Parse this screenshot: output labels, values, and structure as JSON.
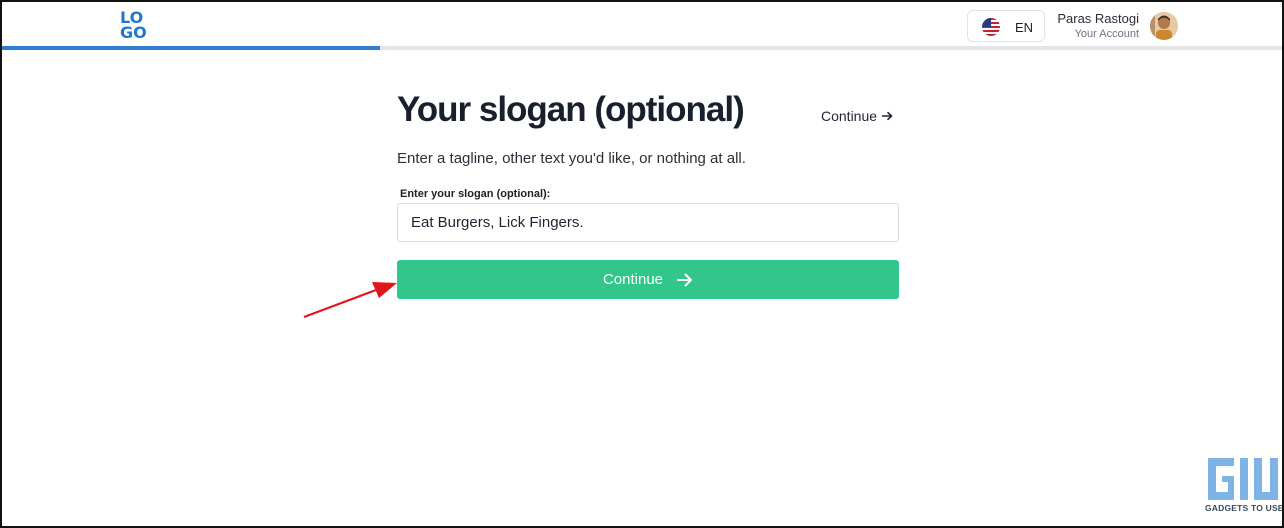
{
  "header": {
    "logo_lines": [
      "LO",
      "GO"
    ],
    "progress_fraction": 0.295,
    "language": {
      "code": "EN",
      "flag_icon": "us-flag-icon"
    },
    "user": {
      "name": "Paras Rastogi",
      "subtitle": "Your Account"
    }
  },
  "main": {
    "title": "Your slogan (optional)",
    "skip_label": "Continue",
    "description": "Enter a tagline, other text you'd like, or nothing at all.",
    "field_label": "Enter your slogan (optional):",
    "slogan_value": "Eat Burgers, Lick Fingers.",
    "continue_label": "Continue"
  },
  "watermark": {
    "text": "GADGETS TO USE"
  },
  "colors": {
    "accent_blue": "#2f7fd1",
    "button_green": "#32c58c",
    "annotation_red": "#e3151b"
  }
}
